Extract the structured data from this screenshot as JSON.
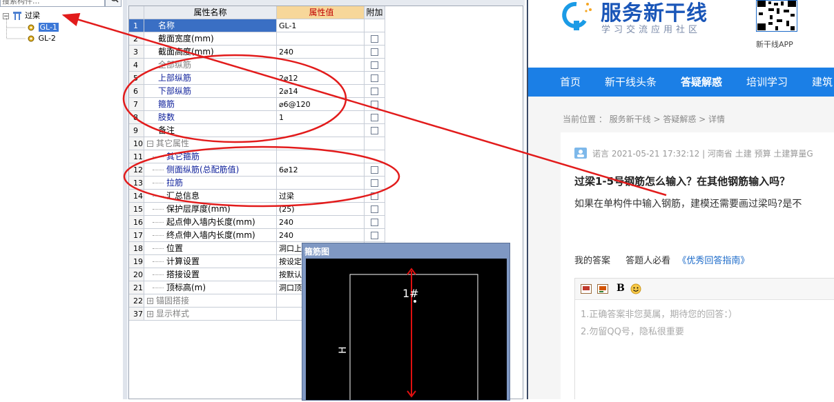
{
  "tree": {
    "search_placeholder": "搜索构件...",
    "root_label": "过梁",
    "nodes": [
      "GL-1",
      "GL-2"
    ]
  },
  "grid": {
    "headers": {
      "name": "属性名称",
      "value": "属性值",
      "extra": "附加"
    },
    "rows": [
      {
        "num": "1",
        "name": "名称",
        "value": "GL-1",
        "check": false,
        "style": "blue"
      },
      {
        "num": "2",
        "name": "截面宽度(mm)",
        "value": "",
        "check": true,
        "style": "black"
      },
      {
        "num": "3",
        "name": "截面高度(mm)",
        "value": "240",
        "check": true,
        "style": "black"
      },
      {
        "num": "4",
        "name": "全部纵筋",
        "value": "",
        "check": true,
        "style": "gray"
      },
      {
        "num": "5",
        "name": "上部纵筋",
        "value": "2⌀12",
        "check": true,
        "style": "blue"
      },
      {
        "num": "6",
        "name": "下部纵筋",
        "value": "2⌀14",
        "check": true,
        "style": "blue"
      },
      {
        "num": "7",
        "name": "箍筋",
        "value": "⌀6@120",
        "check": true,
        "style": "blue"
      },
      {
        "num": "8",
        "name": "肢数",
        "value": "1",
        "check": true,
        "style": "blue"
      },
      {
        "num": "9",
        "name": "备注",
        "value": "",
        "check": true,
        "style": "black"
      },
      {
        "num": "10",
        "name": "其它属性",
        "value": "",
        "check": false,
        "style": "gray",
        "expander": "−"
      },
      {
        "num": "11",
        "name": "其它箍筋",
        "value": "",
        "check": false,
        "style": "blue",
        "child": true
      },
      {
        "num": "12",
        "name": "侧面纵筋(总配筋值)",
        "value": "6⌀12",
        "check": true,
        "style": "blue",
        "child": true
      },
      {
        "num": "13",
        "name": "拉筋",
        "value": "",
        "check": true,
        "style": "blue",
        "child": true
      },
      {
        "num": "14",
        "name": "汇总信息",
        "value": "过梁",
        "check": true,
        "style": "black",
        "child": true
      },
      {
        "num": "15",
        "name": "保护层厚度(mm)",
        "value": "(25)",
        "check": true,
        "style": "black",
        "child": true
      },
      {
        "num": "16",
        "name": "起点伸入墙内长度(mm)",
        "value": "240",
        "check": true,
        "style": "black",
        "child": true
      },
      {
        "num": "17",
        "name": "终点伸入墙内长度(mm)",
        "value": "240",
        "check": true,
        "style": "black",
        "child": true
      },
      {
        "num": "18",
        "name": "位置",
        "value": "洞口上",
        "check": false,
        "style": "black",
        "child": true
      },
      {
        "num": "19",
        "name": "计算设置",
        "value": "按设定",
        "check": false,
        "style": "black",
        "child": true
      },
      {
        "num": "20",
        "name": "搭接设置",
        "value": "按默认",
        "check": false,
        "style": "black",
        "child": true
      },
      {
        "num": "21",
        "name": "顶标高(m)",
        "value": "洞口顶",
        "check": false,
        "style": "black",
        "child": true
      },
      {
        "num": "22",
        "name": "锚固搭接",
        "value": "",
        "check": false,
        "style": "gray",
        "expander": "+"
      },
      {
        "num": "37",
        "name": "显示样式",
        "value": "",
        "check": false,
        "style": "gray",
        "expander": "+"
      }
    ]
  },
  "rebar_popup": {
    "title": "箍筋图",
    "label_bar": "1#",
    "label_h": "H"
  },
  "web": {
    "logo_text": "服务新干线",
    "logo_sub": "学习交流应用社区",
    "app_label": "新干线APP",
    "nav": [
      "首页",
      "新干线头条",
      "答疑解惑",
      "培训学习",
      "建筑"
    ],
    "breadcrumb": "当前位置 ： 服务新干线 > 答疑解惑 > 详情",
    "meta": "诺言    2021-05-21 17:32:12    |    河南省  土建 预算 土建算量G",
    "question_title": "过梁1-5号钢筋怎么输入？在其他钢筋输入吗？",
    "question_body": "如果在单构件中输入钢筋，建模还需要画过梁吗?是不",
    "answer_tabs": {
      "mine": "我的答案",
      "must": "答题人必看",
      "guide": "《优秀回答指南》"
    },
    "editor_bold": "B",
    "editor_ph1": "1.正确答案非您莫属，期待您的回答：）",
    "editor_ph2": "2.勿留QQ号，隐私很重要"
  },
  "colors": {
    "annotation": "#e21b1b",
    "nav": "#1b7fe6",
    "selection": "#3a6fc4",
    "value_header": "#f7d79a"
  }
}
